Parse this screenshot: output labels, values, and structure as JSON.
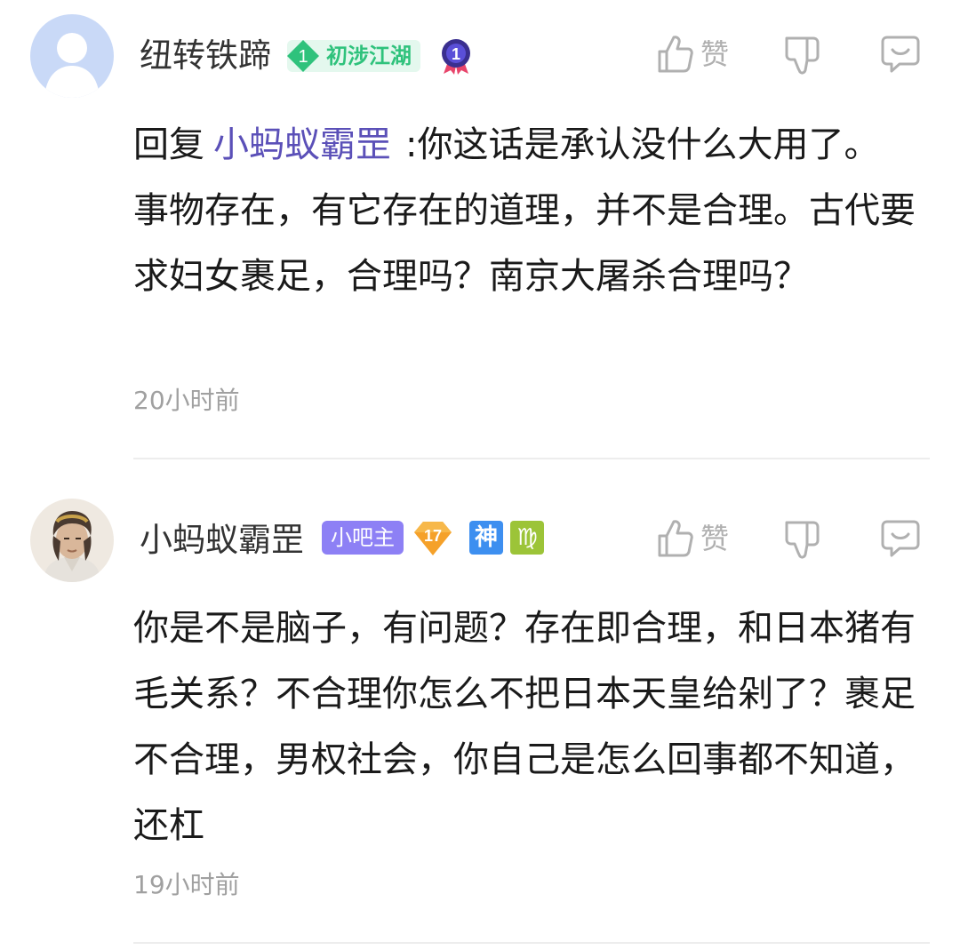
{
  "comments": [
    {
      "username": "纽转铁蹄",
      "level_number": "1",
      "level_title": "初涉江湖",
      "reply_prefix": "回复",
      "mention": "小蚂蚁霸罡",
      "text": ":你这话是承认没什么大用了。 事物存在，有它存在的道理，并不是合理。古代要求妇女裹足，合理吗？南京大屠杀合理吗？",
      "time": "20小时前",
      "like_label": "赞"
    },
    {
      "username": "小蚂蚁霸罡",
      "owner_badge": "小吧主",
      "level_number": "17",
      "badge_shen": "神",
      "badge_zodiac": "♍",
      "text": "你是不是脑子，有问题？存在即合理，和日本猪有毛关系？不合理你怎么不把日本天皇给剁了？裹足不合理，男权社会，你自己是怎么回事都不知道，还杠",
      "time": "19小时前",
      "like_label": "赞"
    }
  ],
  "colors": {
    "mention": "#5b50b8",
    "level_green": "#2fc27c",
    "owner_purple": "#8d80f5",
    "level17_orange": "#f5a12a",
    "badge_blue": "#3d8ff0",
    "badge_green": "#9cc438"
  },
  "icons": {
    "like": "thumbs-up-icon",
    "dislike": "thumbs-down-icon",
    "reply": "comment-bubble-icon"
  }
}
